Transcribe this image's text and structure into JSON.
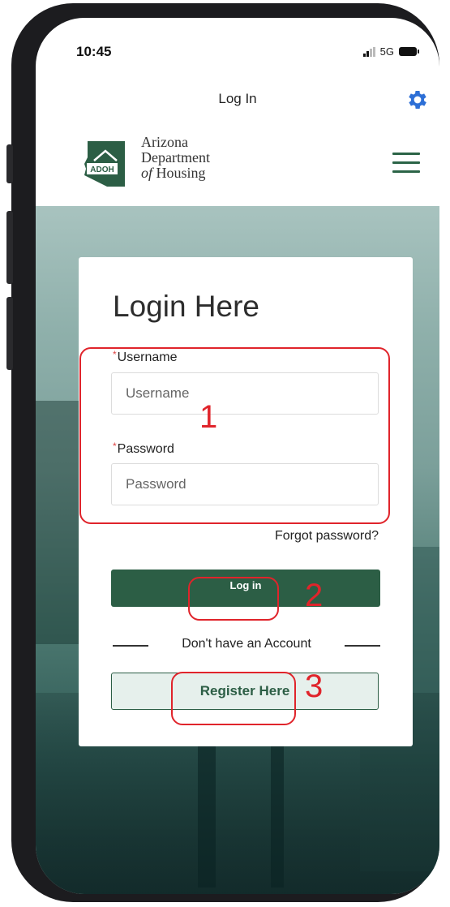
{
  "status_bar": {
    "time": "10:45",
    "network": "5G"
  },
  "title_bar": {
    "title": "Log In",
    "settings_icon": "gear-icon"
  },
  "header": {
    "logo_badge": "ADOH",
    "logo_line1": "Arizona",
    "logo_line2": "Department",
    "logo_line3_italic": "of",
    "logo_line3_rest": " Housing",
    "menu_icon": "hamburger-menu-icon"
  },
  "login": {
    "heading": "Login Here",
    "required_mark": "*",
    "username_label": "Username",
    "username_placeholder": "Username",
    "username_value": "",
    "password_label": "Password",
    "password_placeholder": "Password",
    "password_value": "",
    "forgot_link": "Forgot password?",
    "login_button": "Log in",
    "divider_text": "Don't have an Account",
    "register_button": "Register Here"
  },
  "annotations": {
    "n1": "1",
    "n2": "2",
    "n3": "3"
  },
  "colors": {
    "brand_green": "#2c5e45",
    "annotation_red": "#e0242b"
  }
}
